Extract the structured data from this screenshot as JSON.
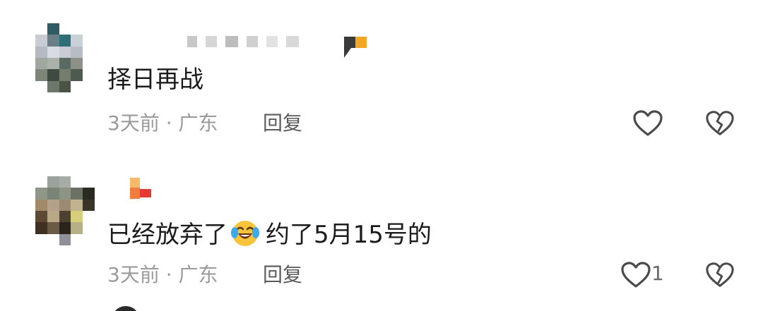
{
  "comments": [
    {
      "text": "择日再战",
      "meta": "3天前 · 广东",
      "reply_label": "回复",
      "like_icon": "heart-outline-icon",
      "dislike_icon": "broken-heart-icon"
    },
    {
      "text_before_emoji": "已经放弃了",
      "emoji": "crying-laughing-emoji",
      "text_after_emoji": "约了5月15号的",
      "meta": "3天前 · 广东",
      "reply_label": "回复",
      "like_count": "1",
      "like_icon": "heart-outline-icon",
      "dislike_icon": "broken-heart-icon"
    }
  ],
  "colors": {
    "text_primary": "#1b1b1b",
    "text_meta": "#9a9a9a",
    "reply_text": "#5a5a5a",
    "icon_stroke": "#4a4a4a"
  }
}
